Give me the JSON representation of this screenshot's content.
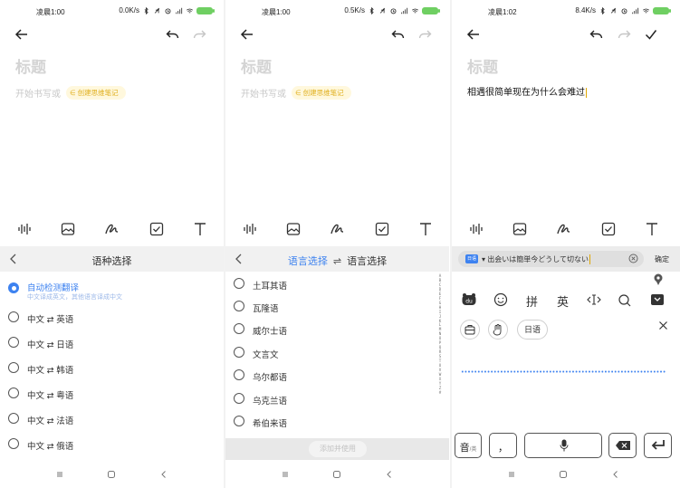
{
  "panels": [
    {
      "status": {
        "time": "凌晨1:00",
        "net": "0.0K/s",
        "battery": "85"
      },
      "editor": {
        "title_placeholder": "标题",
        "body_placeholder": "开始书写或",
        "mind_map_chip": "创建思维笔记"
      },
      "lang_select": {
        "title": "语种选择",
        "options": [
          {
            "label": "自动检测翻译",
            "sub": "中文译成英文，其他语言译成中文",
            "selected": true
          },
          {
            "label": "中文 ⇄ 英语",
            "selected": false
          },
          {
            "label": "中文 ⇄ 日语",
            "selected": false
          },
          {
            "label": "中文 ⇄ 韩语",
            "selected": false
          },
          {
            "label": "中文 ⇄ 粤语",
            "selected": false
          },
          {
            "label": "中文 ⇄ 法语",
            "selected": false
          },
          {
            "label": "中文 ⇄ 俄语",
            "selected": false
          }
        ]
      }
    },
    {
      "status": {
        "time": "凌晨1:00",
        "net": "0.5K/s",
        "battery": "85"
      },
      "editor": {
        "title_placeholder": "标题",
        "body_placeholder": "开始书写或",
        "mind_map_chip": "创建思维笔记"
      },
      "lang_select": {
        "tab_active": "语言选择",
        "swap": "⇌",
        "tab_other": "语言选择",
        "options": [
          {
            "label": "土耳其语"
          },
          {
            "label": "瓦隆语"
          },
          {
            "label": "威尔士语"
          },
          {
            "label": "文言文"
          },
          {
            "label": "乌尔都语"
          },
          {
            "label": "乌克兰语"
          },
          {
            "label": "希伯来语"
          }
        ],
        "alphabet": [
          "A",
          "B",
          "C",
          "D",
          "E",
          "F",
          "G",
          "H",
          "I",
          "J",
          "K",
          "L",
          "M",
          "N",
          "O",
          "P",
          "Q",
          "R",
          "S",
          "T",
          "U",
          "V",
          "W",
          "X",
          "Y",
          "Z",
          "#"
        ],
        "add_button": "添加并使用"
      }
    },
    {
      "status": {
        "time": "凌晨1:02",
        "net": "8.4K/s",
        "battery": "85"
      },
      "editor": {
        "title_placeholder": "标题",
        "body_text": "相遇很简单现在为什么会难过"
      },
      "ime": {
        "tag": "日语",
        "input_text": "出会いは簡単今どうして切ない",
        "confirm": "确定",
        "pinyin_label": "拼",
        "english_label": "英",
        "lang_chip": "日语",
        "keys": {
          "cn_en": "音",
          "cn_en_small": "/英",
          "punct": "，"
        }
      }
    }
  ]
}
